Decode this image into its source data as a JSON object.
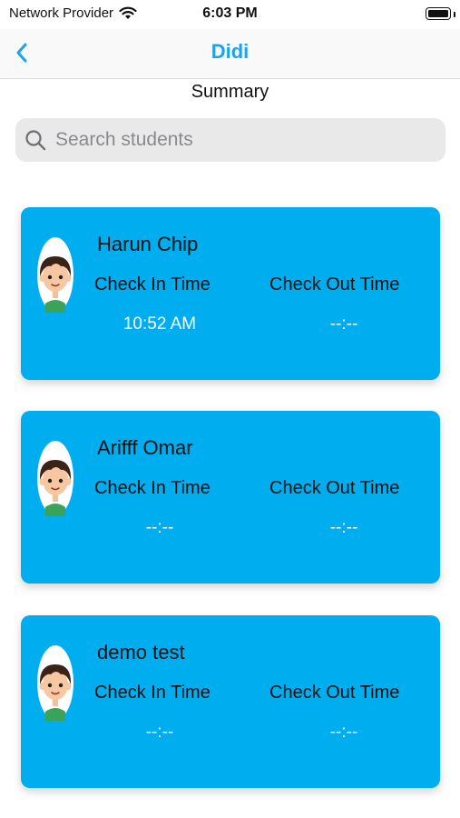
{
  "status_bar": {
    "carrier": "Network Provider",
    "time": "6:03 PM"
  },
  "nav": {
    "title": "Didi"
  },
  "page": {
    "subtitle": "Summary"
  },
  "search": {
    "placeholder": "Search students",
    "value": ""
  },
  "students": [
    {
      "name": "Harun Chip",
      "check_in_label": "Check In Time",
      "check_out_label": "Check Out Time",
      "check_in": "10:52 AM",
      "check_out": "--:--"
    },
    {
      "name": "Arifff Omar",
      "check_in_label": "Check In Time",
      "check_out_label": "Check Out Time",
      "check_in": "--:--",
      "check_out": "--:--"
    },
    {
      "name": "demo test",
      "check_in_label": "Check In Time",
      "check_out_label": "Check Out Time",
      "check_in": "--:--",
      "check_out": "--:--"
    }
  ],
  "colors": {
    "accent": "#1ba5e8",
    "card": "#00adef"
  }
}
